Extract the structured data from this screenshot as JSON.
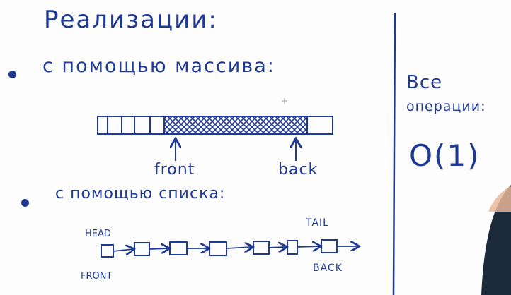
{
  "board": {
    "title": "Реализации:",
    "bullet1": "с помощью массива:",
    "bullet2": "с помощью списка:",
    "array_front_label": "front",
    "array_back_label": "back",
    "list_head_label": "HEAD",
    "list_tail_label": "TAIL",
    "list_front_label": "FRONT",
    "list_back_label": "BACK",
    "side_line1": "Все",
    "side_line2": "операции:",
    "side_complexity": "O(1)"
  },
  "colors": {
    "ink": "#1f3a93",
    "background": "#fdfdfd",
    "skin": "#e9b79a",
    "jacket": "#1d2a3a"
  },
  "array": {
    "empty_cells": 5,
    "filled_cells": 1
  },
  "list": {
    "nodes": 7
  }
}
